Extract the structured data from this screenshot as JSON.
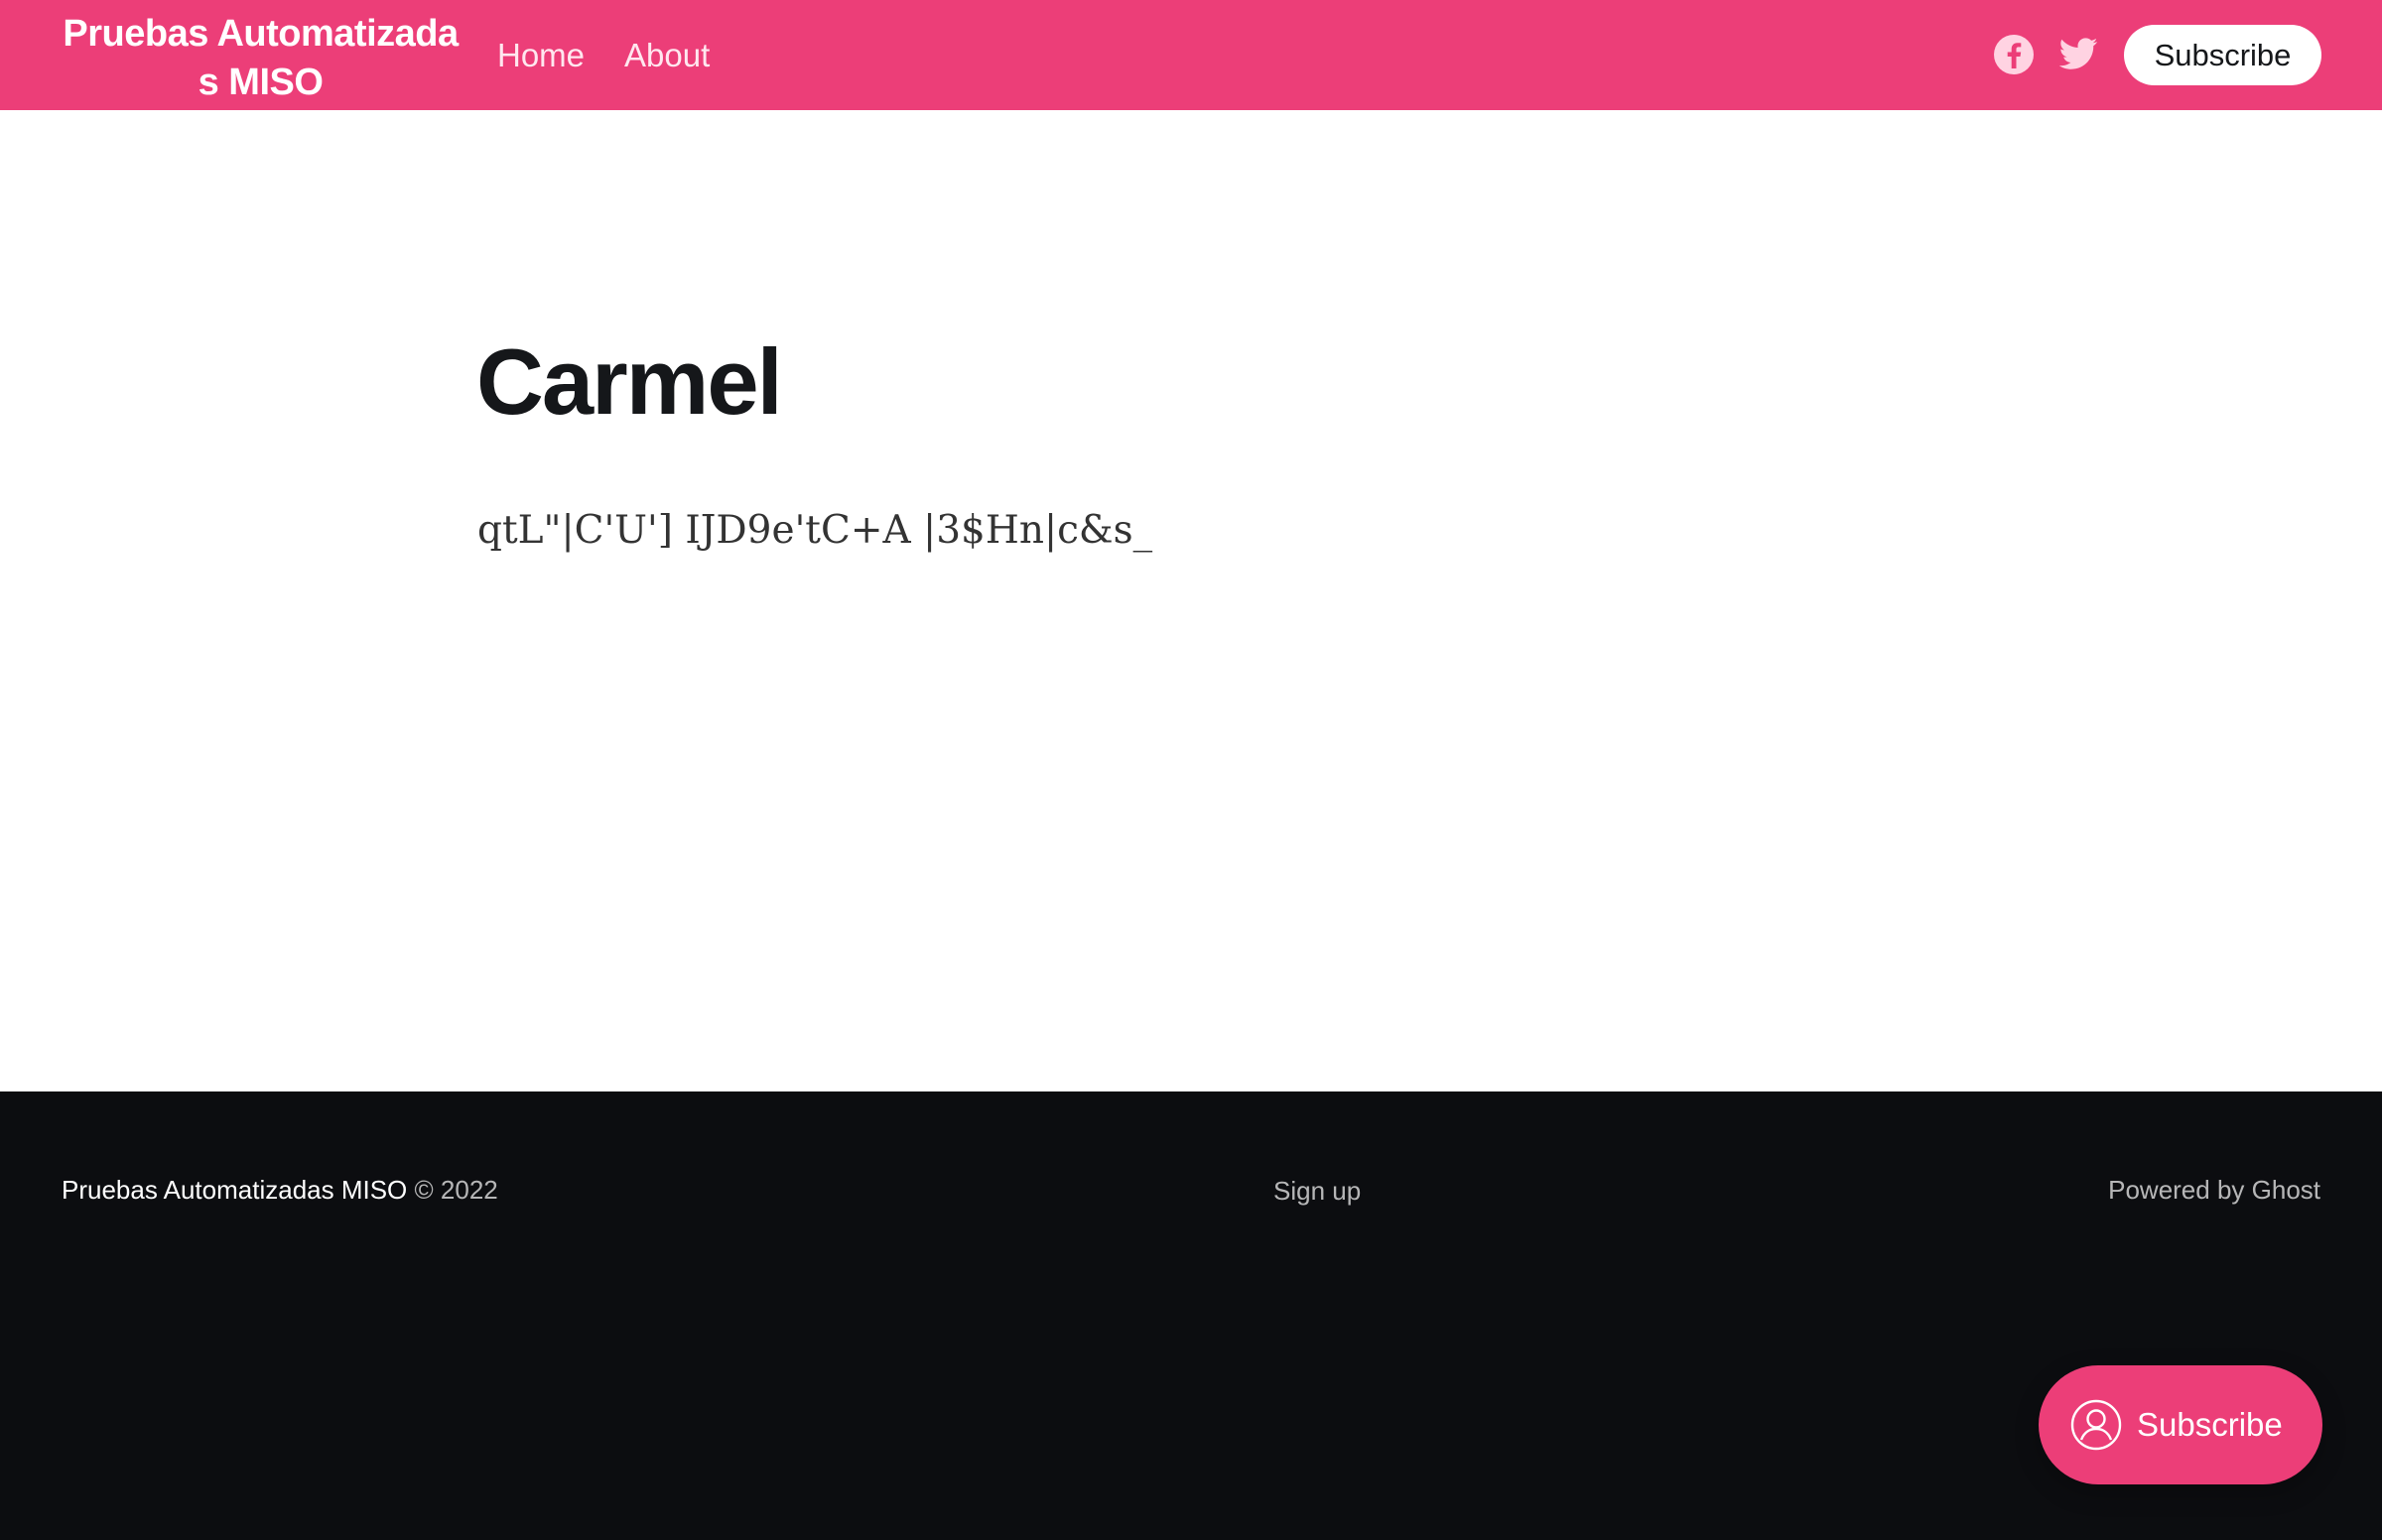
{
  "header": {
    "site_title": "Pruebas Automatizadas MISO",
    "nav": [
      {
        "label": "Home"
      },
      {
        "label": "About"
      }
    ],
    "social": [
      "facebook-icon",
      "twitter-icon"
    ],
    "subscribe_label": "Subscribe"
  },
  "main": {
    "title": "Carmel",
    "text": "qtL\"|C'U'] IJD9e'tC+A |3$Hn|c&s_"
  },
  "footer": {
    "site_name": "Pruebas Automatizadas MISO",
    "copyright": " © 2022",
    "signup": "Sign up",
    "powered": "Powered by Ghost"
  },
  "portal": {
    "label": "Subscribe",
    "icon": "user-circle-icon"
  },
  "colors": {
    "accent": "#ec3e78",
    "footer_bg": "#0c0d10",
    "text_dark": "#15171a"
  }
}
